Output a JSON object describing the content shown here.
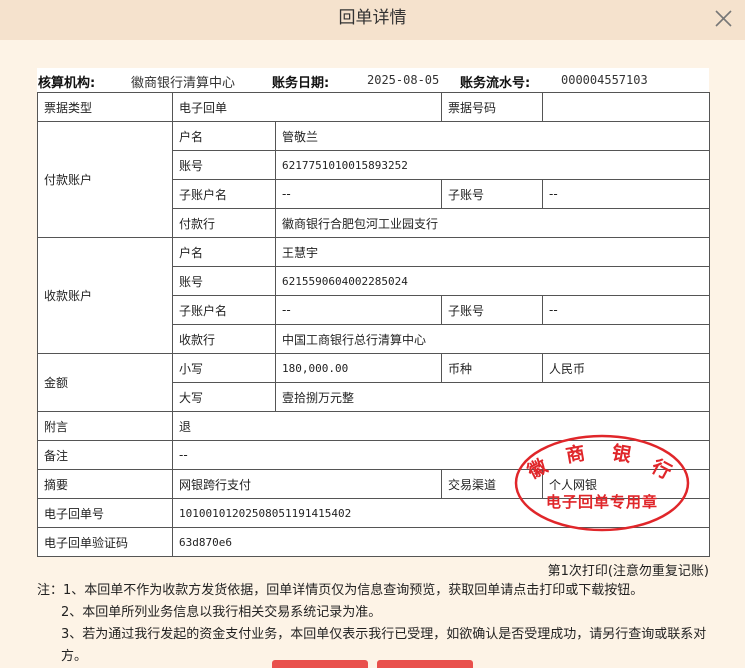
{
  "dialog": {
    "title": "回单详情"
  },
  "header": {
    "org_label": "核算机构:",
    "org_value": "徽商银行清算中心",
    "date_label": "账务日期:",
    "date_value": "2025-08-05",
    "serial_label": "账务流水号:",
    "serial_value": "000004557103"
  },
  "table": {
    "bill_type_label": "票据类型",
    "bill_type_value": "电子回单",
    "bill_no_label": "票据号码",
    "bill_no_value": "",
    "payer": {
      "section": "付款账户",
      "name_label": "户名",
      "name": "管敬兰",
      "acct_label": "账号",
      "acct": "6217751010015893252",
      "sub_name_label": "子账户名",
      "sub_name": "--",
      "sub_no_label": "子账号",
      "sub_no": "--",
      "bank_label": "付款行",
      "bank": "徽商银行合肥包河工业园支行"
    },
    "payee": {
      "section": "收款账户",
      "name_label": "户名",
      "name": "王慧宇",
      "acct_label": "账号",
      "acct": "6215590604002285024",
      "sub_name_label": "子账户名",
      "sub_name": "--",
      "sub_no_label": "子账号",
      "sub_no": "--",
      "bank_label": "收款行",
      "bank": "中国工商银行总行清算中心"
    },
    "amount": {
      "section": "金额",
      "small_label": "小写",
      "small": "180,000.00",
      "currency_label": "币种",
      "currency": "人民币",
      "big_label": "大写",
      "big": "壹拾捌万元整"
    },
    "postscript_label": "附言",
    "postscript": "退",
    "remark_label": "备注",
    "remark": "--",
    "summary_label": "摘要",
    "summary": "网银跨行支付",
    "channel_label": "交易渠道",
    "channel": "个人网银",
    "receipt_no_label": "电子回单号",
    "receipt_no": "10100101202508051191415402",
    "verify_label": "电子回单验证码",
    "verify": "63d870e6"
  },
  "stamp": {
    "bank_name": "徽 商 银 行",
    "text": "电子回单专用章",
    "color": "#e0262a"
  },
  "print_note": "第1次打印(注意勿重复记账)",
  "notes": [
    "注：1、本回单不作为收款方发货依据，回单详情页仅为信息查询预览，获取回单请点击打印或下载按钮。",
    "2、本回单所列业务信息以我行相关交易系统记录为准。",
    "3、若为通过我行发起的资金支付业务，本回单仅表示我行已受理，如欲确认是否受理成功，请另行查询或联系对方。"
  ]
}
